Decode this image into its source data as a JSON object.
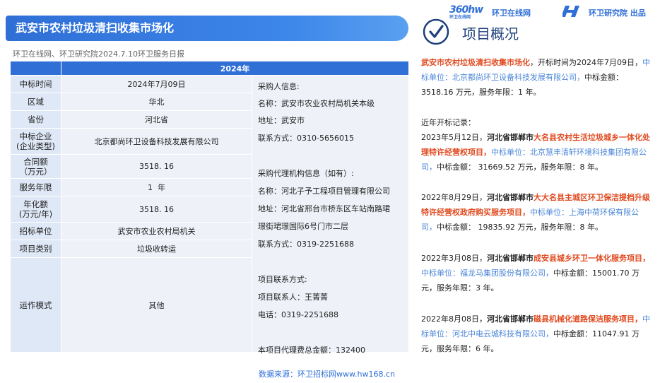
{
  "header": {
    "title": "武安市农村垃圾清扫收集市场化",
    "source_line": "环卫在线网、环卫研究院2024.7.10环卫服务日报",
    "logo_360_text": "360hw",
    "logo_360_sub": "环卫在线网",
    "logo_site": "环卫在线网",
    "logo_institute": "环卫研究院 出品"
  },
  "table": {
    "year": "2024年",
    "rows": [
      {
        "label": "中标时间",
        "value": "2024年7月09日"
      },
      {
        "label": "区域",
        "value": "华北"
      },
      {
        "label": "省份",
        "value": "河北省"
      },
      {
        "label": "中标企业\n(企业类型)",
        "value": "北京都尚环卫设备科技发展有限公司"
      },
      {
        "label": "合同额\n（万元）",
        "value": "3518. 16"
      },
      {
        "label": "服务年限",
        "value": "1  年"
      },
      {
        "label": "年化额\n(万元/年)",
        "value": "3518. 16"
      },
      {
        "label": "招标单位",
        "value": "武安市农业农村局机关"
      },
      {
        "label": "项目类别",
        "value": "垃圾收转运"
      },
      {
        "label": "运作模式",
        "value": "其他"
      }
    ],
    "info_lines": [
      "采购人信息:",
      "名称：武安市农业农村局机关本级",
      "地址：武安市",
      "联系方式：0310-5656015",
      "采购代理机构信息（如有）:",
      "名称：河北子予工程项目管理有限公司",
      "地址：河北省邢台市桥东区车站南路珺",
      "璟街珺璟国际6号门市二层",
      "联系方式：0319-2251688",
      "项目联系方式:",
      "项目联系人：王菁菁",
      "电话：0319-2251688",
      "本项目代理费总金额：132400"
    ]
  },
  "footer": {
    "source": "数据来源：环卫招标网www.hw168.cn"
  },
  "overview": {
    "title": "项目概况",
    "intro": {
      "project": "武安市农村垃圾清扫收集市场化",
      "open_time": "，开标时间为2024年7月09日，",
      "winner": "中标单位：北京都尚环卫设备科技发展有限公司，",
      "amount": "中标金额：3518.16 万元，服务年限：1 年。"
    },
    "recent_label": "近年开标记录：",
    "records": [
      {
        "date": "2023年5月12日，",
        "region": "河北省邯郸市",
        "project": "大名县农村生活垃圾城乡一体化处理特许经营权项目",
        "winner": "中标单位：北京慧丰清轩环境科技集团有限公司，",
        "amount": "中标金额： 31669.52 万元，服务年限：8 年。"
      },
      {
        "date": "2022年8月29日，",
        "region": "河北省邯郸市",
        "project": "大大名县主城区环卫保洁提档升级特许经营权政府购买服务项目",
        "winner": "中标单位：上海中荷环保有限公司，",
        "amount": "中标金额： 19835.92 万元，服务年限：8 年。"
      },
      {
        "date": "2022年3月08日，",
        "region": "河北省邯郸市",
        "project": "成安县城乡环卫一体化服务项目",
        "winner": "中标单位：福龙马集团股份有限公司，",
        "amount": "中标金额：15001.70 万元，服务年限：3 年。"
      },
      {
        "date": "2022年8月08日，",
        "region": "河北省邯郸市",
        "project": "磁县机械化道路保洁服务项目",
        "winner": "中标单位：河北中电云城科技有限公司，",
        "amount": "中标金额：11047.91 万元，服务年限：6 年。"
      }
    ]
  },
  "colors": {
    "accent": "#2f6fd6",
    "highlight": "#e04a1f",
    "link": "#4a86d8",
    "label_bg": "#dfe8f6",
    "value_bg": "#eef2f8"
  }
}
